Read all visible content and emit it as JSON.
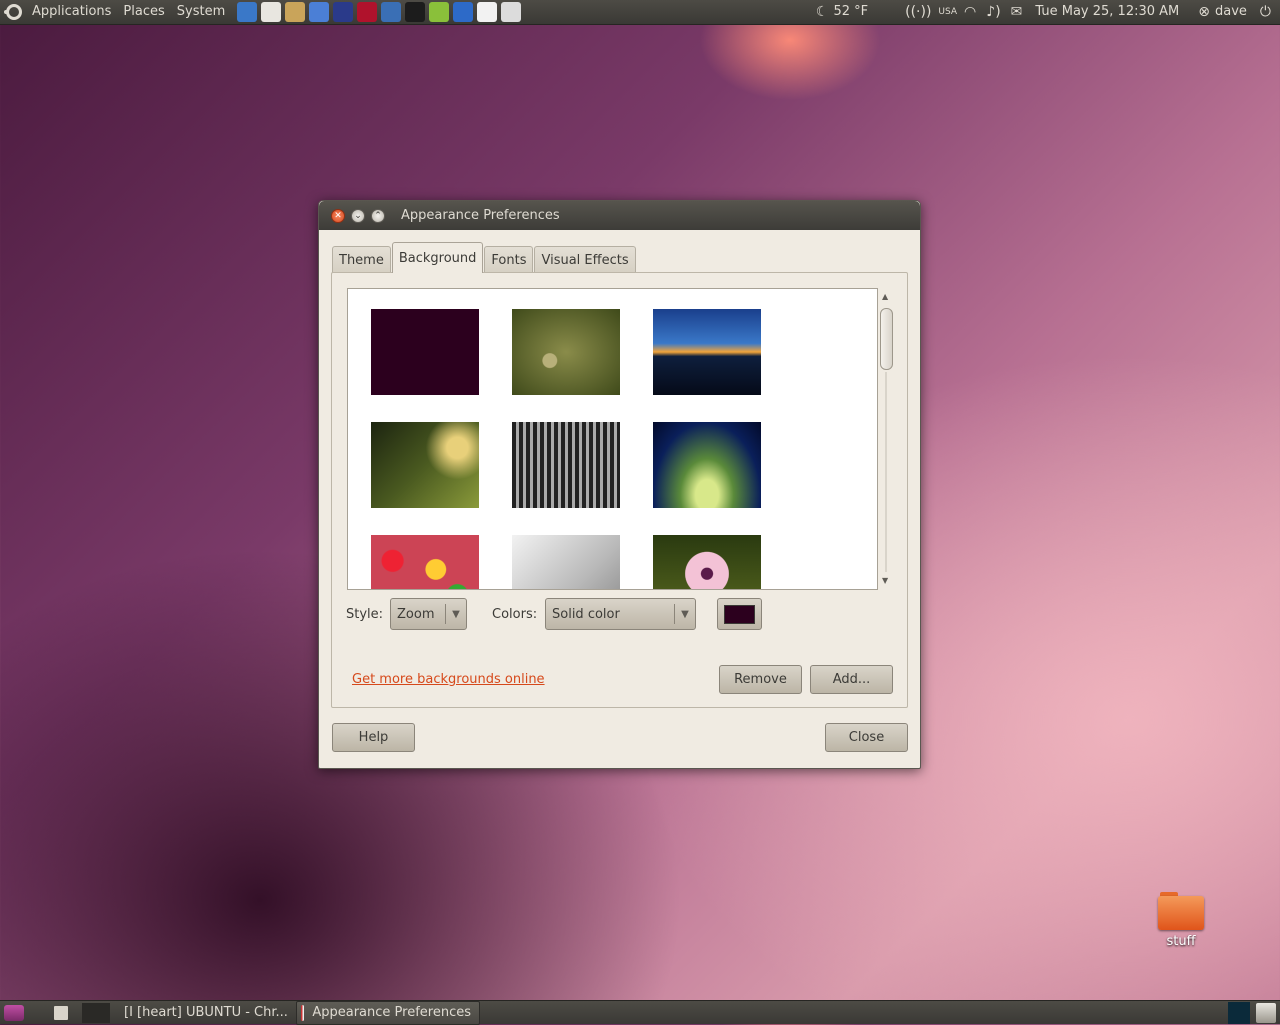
{
  "top_panel": {
    "menus": [
      "Applications",
      "Places",
      "System"
    ],
    "launchers": [
      {
        "name": "chromium-icon",
        "color": "#3a78c8"
      },
      {
        "name": "mail-icon",
        "color": "#e8e6e0"
      },
      {
        "name": "package-icon",
        "color": "#c9a45a"
      },
      {
        "name": "network-icon",
        "color": "#4b7fd6"
      },
      {
        "name": "browser-icon",
        "color": "#2a3a8a"
      },
      {
        "name": "red-app-icon",
        "color": "#b0122c"
      },
      {
        "name": "firefox-icon",
        "color": "#3a6fb5"
      },
      {
        "name": "terminal-icon",
        "color": "#1c1c1c"
      },
      {
        "name": "wine-icon",
        "color": "#8ac03a"
      },
      {
        "name": "screen-icon",
        "color": "#2d6ac8"
      },
      {
        "name": "route66-icon",
        "color": "#f2f2f2"
      },
      {
        "name": "send-icon",
        "color": "#dcdcdc"
      }
    ],
    "weather": "52 °F",
    "keyboard_layout": "USA",
    "datetime": "Tue May 25, 12:30 AM",
    "user": "dave"
  },
  "dialog": {
    "title": "Appearance Preferences",
    "tabs": [
      "Theme",
      "Background",
      "Fonts",
      "Visual Effects"
    ],
    "active_tab": "Background",
    "style_label": "Style:",
    "style_value": "Zoom",
    "colors_label": "Colors:",
    "colors_value": "Solid color",
    "swatch_color": "#2c001e",
    "link": "Get more backgrounds online",
    "remove_button": "Remove",
    "add_button": "Add...",
    "help_button": "Help",
    "close_button": "Close"
  },
  "wallpapers": [
    "solid-aubergine",
    "bird-on-branch",
    "sunset-over-water",
    "tree-branches",
    "classic-car-grille",
    "blue-green-light-rays",
    "colorful-buttons",
    "silver-metal",
    "pink-daisy"
  ],
  "desktop": {
    "folder_label": "stuff"
  },
  "bottom_panel": {
    "tasks": [
      "[I [heart] UBUNTU - Chr...",
      "Appearance Preferences"
    ]
  }
}
